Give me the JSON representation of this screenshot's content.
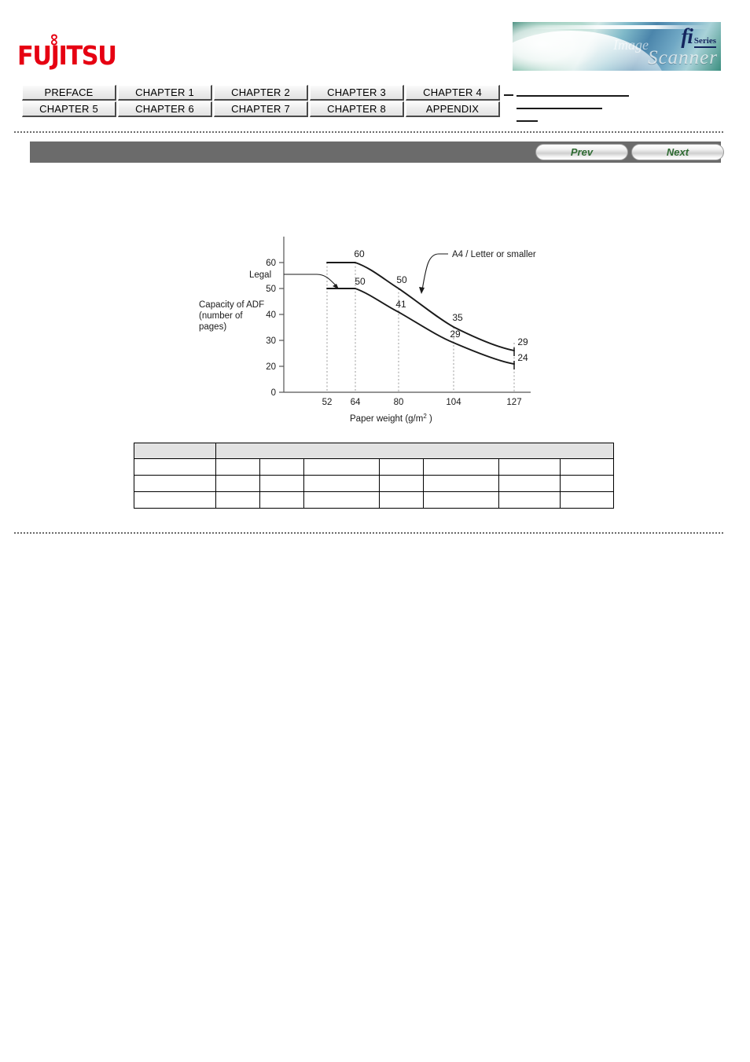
{
  "logo": {
    "name": "FUJITSU",
    "wordmark": "FUJITSU",
    "infinity_glyph": "∞",
    "color": "#e60012"
  },
  "banner": {
    "product_line": "fi",
    "series_label": "Series",
    "script_text": "Scanner",
    "script_text_2": "Image",
    "alt": "fi Series Image Scanner"
  },
  "chapter_nav": {
    "row1": [
      {
        "label": "PREFACE"
      },
      {
        "label": "CHAPTER 1"
      },
      {
        "label": "CHAPTER 2"
      },
      {
        "label": "CHAPTER 3"
      },
      {
        "label": "CHAPTER 4"
      }
    ],
    "row2": [
      {
        "label": "CHAPTER 5"
      },
      {
        "label": "CHAPTER 6"
      },
      {
        "label": "CHAPTER 7"
      },
      {
        "label": "CHAPTER 8"
      },
      {
        "label": "APPENDIX"
      }
    ]
  },
  "navbar": {
    "prev_label": "Prev",
    "next_label": "Next",
    "bar_color": "#6b6b6b",
    "link_color": "#2f6b33"
  },
  "chart_data": {
    "type": "line",
    "title": "",
    "xlabel": "Paper weight (g/m2)",
    "xlabel_base": "Paper weight (g/m",
    "xlabel_sup": "2",
    "xlabel_tail": ")",
    "ylabel_line1": "Capacity of ADF",
    "ylabel_line2": "(number of",
    "ylabel_line3": "pages)",
    "x": [
      52,
      64,
      80,
      104,
      127
    ],
    "x_ticks": [
      "52",
      "64",
      "80",
      "104",
      "127"
    ],
    "y_ticks": [
      "0",
      "20",
      "30",
      "40",
      "50",
      "60"
    ],
    "ylim": [
      0,
      65
    ],
    "xlim": [
      40,
      140
    ],
    "grid": "vertical-dotted",
    "legend_position": "annotations",
    "series": [
      {
        "name": "A4 / Letter or smaller",
        "annotation": "A4 / Letter or smaller",
        "values": [
          60,
          60,
          50,
          35,
          29
        ],
        "labels": [
          "60",
          "50",
          "35",
          "29"
        ]
      },
      {
        "name": "Legal",
        "annotation": "Legal",
        "values": [
          50,
          50,
          41,
          29,
          24
        ],
        "labels": [
          "50",
          "41",
          "29",
          "24"
        ]
      }
    ],
    "point_labels": [
      {
        "text": "60",
        "series": "A4 / Letter or smaller",
        "x": 64,
        "y": 60
      },
      {
        "text": "50",
        "series": "A4 / Letter or smaller",
        "x": 80,
        "y": 50
      },
      {
        "text": "35",
        "series": "A4 / Letter or smaller",
        "x": 104,
        "y": 35
      },
      {
        "text": "29",
        "series": "A4 / Letter or smaller",
        "x": 127,
        "y": 29
      },
      {
        "text": "50",
        "series": "Legal",
        "x": 64,
        "y": 50
      },
      {
        "text": "41",
        "series": "Legal",
        "x": 80,
        "y": 41
      },
      {
        "text": "29",
        "series": "Legal",
        "x": 104,
        "y": 29
      },
      {
        "text": "24",
        "series": "Legal",
        "x": 127,
        "y": 24
      }
    ]
  },
  "spec_table": {
    "columns": 8,
    "header_cells": [
      "",
      ""
    ],
    "rows": [
      [
        "",
        "",
        "",
        "",
        "",
        "",
        "",
        ""
      ],
      [
        "",
        "",
        "",
        "",
        "",
        "",
        "",
        ""
      ],
      [
        "",
        "",
        "",
        "",
        "",
        "",
        "",
        ""
      ]
    ]
  }
}
